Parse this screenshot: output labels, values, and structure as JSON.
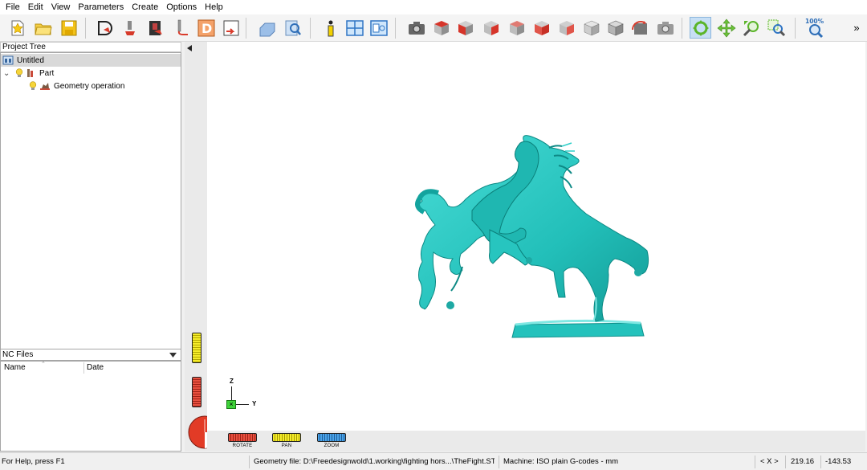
{
  "menu": {
    "items": [
      {
        "id": "file",
        "label": "File"
      },
      {
        "id": "edit",
        "label": "Edit"
      },
      {
        "id": "view",
        "label": "View"
      },
      {
        "id": "parameters",
        "label": "Parameters"
      },
      {
        "id": "create",
        "label": "Create"
      },
      {
        "id": "options",
        "label": "Options"
      },
      {
        "id": "help",
        "label": "Help"
      }
    ]
  },
  "toolbar": {
    "zoom_level": "100%",
    "overflow_label": "»",
    "icons": [
      "new-file-icon",
      "open-folder-icon",
      "save-icon",
      "import-geometry-icon",
      "tool-path-icon",
      "simulation-icon",
      "probe-icon",
      "design-d-icon",
      "export-icon",
      "part-view-icon",
      "find-icon",
      "info-icon",
      "layout-icon",
      "window-icon",
      "camera-icon",
      "view-top-cube-icon",
      "view-front-cube-icon",
      "view-right-cube-icon",
      "view-back-cube-icon",
      "view-left-cube-icon",
      "view-bottom-cube-icon",
      "view-iso-cube-icon",
      "view-wire-cube-icon",
      "rotate-view-icon",
      "snapshot-icon",
      "rotate-mode-icon",
      "pan-mode-icon",
      "zoom-mode-icon",
      "zoom-window-icon",
      "zoom-fit-icon"
    ]
  },
  "project_tree": {
    "header": "Project Tree",
    "root": "Untitled",
    "part": "Part",
    "operation": "Geometry operation"
  },
  "nc_files": {
    "header": "NC Files",
    "columns": [
      "Name",
      "Date"
    ]
  },
  "viewport": {
    "axis_z": "Z",
    "axis_y": "Y",
    "model_color": "#2bc9c4",
    "nav": {
      "rotate": "ROTATE",
      "pan": "PAN",
      "zoom": "ZOOM"
    }
  },
  "status": {
    "help": "For Help, press F1",
    "geometry_file": "Geometry file: D:\\Freedesignwold\\1.working\\fighting hors...\\TheFight.STL",
    "machine": "Machine: ISO plain G-codes - mm",
    "nav_arrows": "< X >",
    "x_value": "219.16",
    "y_value": "-143.53"
  },
  "colors": {
    "accent_select": "#c7dff5",
    "rotate_red": "#d9392b",
    "pan_yellow": "#e8df18",
    "zoom_blue": "#3b8fd4"
  }
}
